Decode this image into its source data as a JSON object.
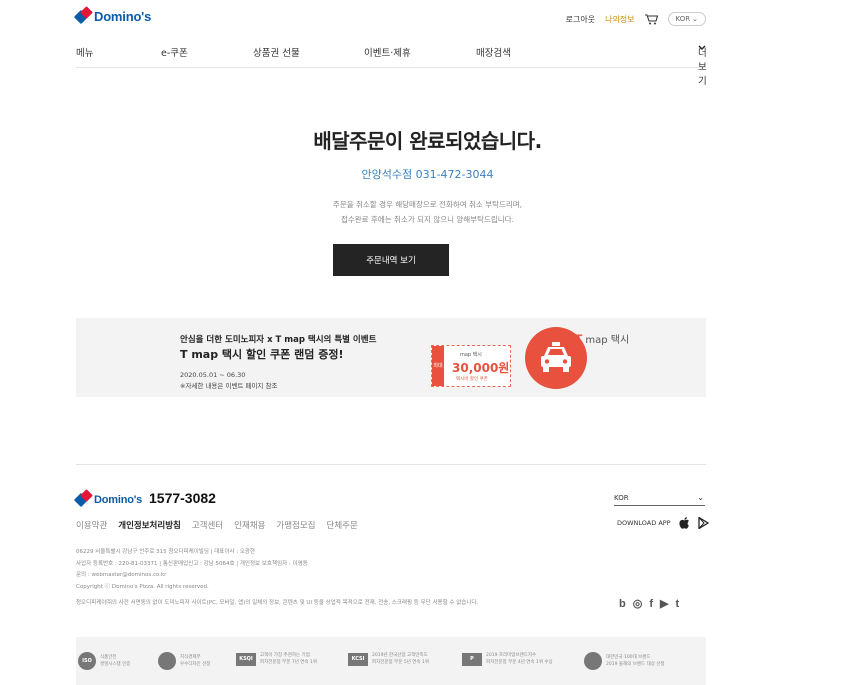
{
  "header": {
    "logo": "Domino's",
    "login": "로그아웃",
    "myinfo": "나의정보",
    "lang": "KOR"
  },
  "nav": {
    "items": [
      "메뉴",
      "e-쿠폰",
      "상품권 선물",
      "이벤트·제휴",
      "매장검색"
    ],
    "more": "더보기"
  },
  "confirm": {
    "title": "배달주문이 완료되었습니다.",
    "store": "안양석수점 031-472-3044",
    "notice_line1": "주문을 취소할 경우 해당매장으로 전화하여 취소 부탁드리며,",
    "notice_line2": "접수완료 후에는 취소가 되지 않으니 양해부탁드립니다.",
    "button": "주문내역 보기"
  },
  "banner": {
    "sub": "안심을 더한 도미노피자 x T map 택시의 특별 이벤트",
    "main": "T map 택시 할인 쿠폰 랜덤 증정!",
    "date": "2020.05.01 ~ 06.30",
    "note": "※자세한 내용은 이벤트 페이지 참조",
    "coupon_side": "최대",
    "coupon_top": "map 택시",
    "coupon_amount": "30,000원",
    "coupon_desc": "택시비 할인 쿠폰",
    "brand_logo": "T",
    "brand_text": "map 택시"
  },
  "footer": {
    "logo": "Domino's",
    "phone": "1577-3082",
    "lang": "KOR",
    "links": [
      "이용약관",
      "개인정보처리방침",
      "고객센터",
      "인재채용",
      "가맹점모집",
      "단체주문"
    ],
    "strong_link_index": 1,
    "download": "DOWNLOAD APP",
    "info_line1": "06229 서울특별시 강남구 언주로 315 청오디피케이빌딩 | 대표이사 : 오광현",
    "info_line2": "사업자 등록번호 : 220-81-03371 | 통신판매업신고 : 강남 5064호 | 개인정보 보호책임자 : 이영동",
    "info_line3": "문의 : webmaster@dominos.co.kr",
    "info_line4": "Copyright ⓒ Domino's Pizza. All rights reserved.",
    "info_line5": "청오디피케이㈜의 사전 서면동의 없이 도미노피자 사이트(PC, 모바일, 앱)의 일체의 정보, 콘텐츠 및 UI 등을 상업적 목적으로 전재, 전송, 스크래핑 등 무단 사용할 수 없습니다.",
    "sns": [
      "b",
      "◎",
      "f",
      "▶",
      "t"
    ]
  },
  "awards": [
    {
      "mark": "ISO",
      "line1": "식품안전",
      "line2": "경영시스템 인증"
    },
    {
      "mark": "",
      "line1": "지식경제부",
      "line2": "우수디자인 선정"
    },
    {
      "mark": "KSQI",
      "line1": "고객이 가장 추천하는 기업",
      "line2": "피자전문점 부문 7년 연속 1위"
    },
    {
      "mark": "KCSI",
      "line1": "2019년 한국산업 고객만족도",
      "line2": "피자전문점 부문 5년 연속 1위"
    },
    {
      "mark": "P",
      "line1": "2019 프리미엄브랜드지수",
      "line2": "피자전문점 부문 4년 연속 1위 수상"
    },
    {
      "mark": "",
      "line1": "대한민국 100대 브랜드",
      "line2": "2019 올해의 브랜드 대상 선정"
    }
  ],
  "colors": {
    "brand_blue": "#0b5ba8",
    "brand_red": "#e31837",
    "store_link": "#3a7fc2",
    "button_bg": "#242424",
    "promo_red": "#e8513e"
  }
}
